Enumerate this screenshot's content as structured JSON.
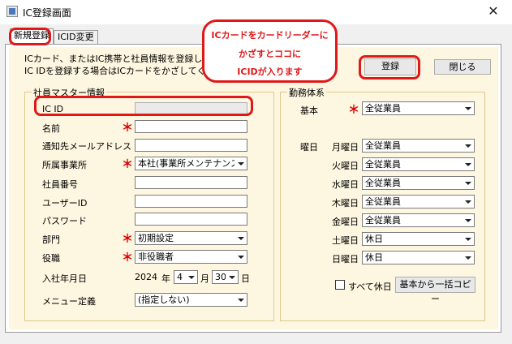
{
  "window": {
    "title": "IC登録画面",
    "close_glyph": "✕"
  },
  "tabs": [
    {
      "label": "新規登録"
    },
    {
      "label": "ICID変更"
    }
  ],
  "intro": {
    "line1": "ICカード、またはIC携帯と社員情報を登録します。",
    "line2": "IC IDを登録する場合はICカードをかざしてください。"
  },
  "buttons": {
    "register": "登録",
    "close": "閉じる",
    "copy_from_basic": "基本から一括コピー"
  },
  "employee_group": {
    "title": "社員マスター情報",
    "fields": {
      "ic_id": {
        "label": "IC ID",
        "value": ""
      },
      "name": {
        "label": "名前",
        "value": ""
      },
      "email": {
        "label": "通知先メールアドレス",
        "value": ""
      },
      "office": {
        "label": "所属事業所",
        "value": "本社(事業所メンテナンス)"
      },
      "employee_no": {
        "label": "社員番号",
        "value": ""
      },
      "user_id": {
        "label": "ユーザーID",
        "value": ""
      },
      "password": {
        "label": "パスワード",
        "value": ""
      },
      "department": {
        "label": "部門",
        "value": "初期設定"
      },
      "position": {
        "label": "役職",
        "value": "非役職者"
      },
      "hire_date": {
        "label": "入社年月日",
        "year": "2024",
        "year_unit": "年",
        "month": "4",
        "month_unit": "月",
        "day": "30",
        "day_unit": "日"
      },
      "menu": {
        "label": "メニュー定義",
        "value": "(指定しない)"
      }
    },
    "required_mark": "＊"
  },
  "work_group": {
    "title": "勤務体系",
    "basic": {
      "label": "基本",
      "value": "全従業員"
    },
    "weekday_label": "曜日",
    "days": [
      {
        "label": "月曜日",
        "value": "全従業員"
      },
      {
        "label": "火曜日",
        "value": "全従業員"
      },
      {
        "label": "水曜日",
        "value": "全従業員"
      },
      {
        "label": "木曜日",
        "value": "全従業員"
      },
      {
        "label": "金曜日",
        "value": "全従業員"
      },
      {
        "label": "土曜日",
        "value": "休日"
      },
      {
        "label": "日曜日",
        "value": "休日"
      }
    ],
    "all_holiday": {
      "label": "すべて休日",
      "checked": false
    }
  },
  "callout": {
    "line1": "ICカードをカードリーダーに",
    "line2": "かざすとココに",
    "line3": "ICIDが入ります"
  },
  "colors": {
    "highlight": "#e01818",
    "panel": "#fdf6e0",
    "required": "#e00000"
  }
}
